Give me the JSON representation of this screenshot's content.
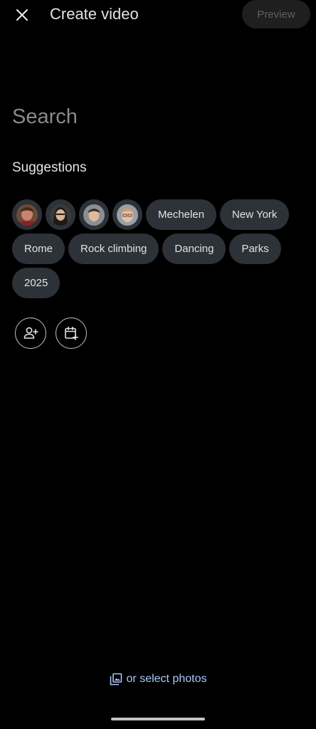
{
  "header": {
    "title": "Create video",
    "preview_label": "Preview",
    "close_icon": "close-icon"
  },
  "search": {
    "placeholder": "Search"
  },
  "suggestions": {
    "label": "Suggestions",
    "people": [
      {
        "icon": "person-avatar-1"
      },
      {
        "icon": "person-avatar-2"
      },
      {
        "icon": "person-avatar-3"
      },
      {
        "icon": "person-avatar-4"
      }
    ],
    "places": [
      "Mechelen",
      "New York",
      "Rome"
    ],
    "things": [
      "Rock climbing",
      "Dancing",
      "Parks"
    ],
    "years": [
      "2025"
    ]
  },
  "actions": {
    "add_person_icon": "add-person-icon",
    "add_date_icon": "add-date-icon"
  },
  "footer": {
    "select_photos_label": "or select photos",
    "select_photos_icon": "photo-library-icon"
  },
  "colors": {
    "background": "#000000",
    "chip": "#2d3138",
    "link": "#a8c7fa",
    "preview_bg": "#1f1f1f",
    "preview_text": "#5f5f5f"
  }
}
